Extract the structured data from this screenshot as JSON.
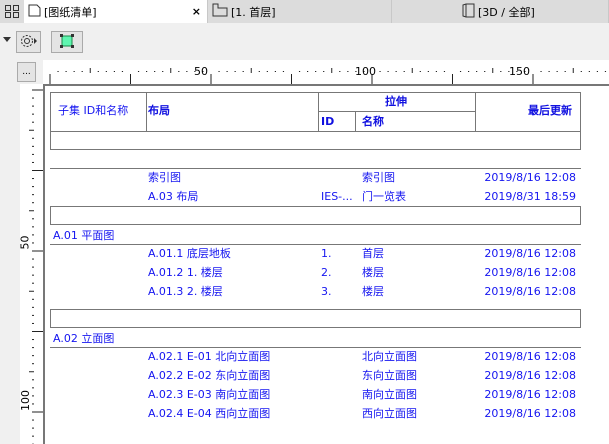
{
  "tabs": [
    {
      "label": "[图纸清单]",
      "icon": "document-icon",
      "active": true
    },
    {
      "label": "[1. 首层]",
      "icon": "floor-plan-icon"
    },
    {
      "label": "[3D / 全部]",
      "icon": "3d-box-icon"
    }
  ],
  "close_label": "×",
  "ruler": {
    "top_ticks": [
      "50",
      "100",
      "150"
    ],
    "left_ticks": [
      "50",
      "100"
    ],
    "corner": "..."
  },
  "header": {
    "col1": "子集 ID和名称",
    "col2": "布局",
    "group": "拉伸",
    "id": "ID",
    "name": "名称",
    "updated": "最后更新"
  },
  "rows_top": [
    {
      "layout": "索引图",
      "id": "",
      "name": "索引图",
      "date": "2019/8/16 12:08"
    },
    {
      "layout": "A.03 布局",
      "id": "IES-...",
      "name": "门一览表",
      "date": "2019/8/31 18:59"
    }
  ],
  "sections": [
    {
      "title": "A.01 平面图",
      "rows": [
        {
          "layout": "A.01.1 底层地板",
          "id": "1.",
          "name": "首层",
          "date": "2019/8/16 12:08"
        },
        {
          "layout": "A.01.2 1. 楼层",
          "id": "2.",
          "name": "楼层",
          "date": "2019/8/16 12:08"
        },
        {
          "layout": "A.01.3 2. 楼层",
          "id": "3.",
          "name": "楼层",
          "date": "2019/8/16 12:08"
        }
      ]
    },
    {
      "title": "A.02 立面图",
      "rows": [
        {
          "layout": "A.02.1 E-01 北向立面图",
          "id": "",
          "name": "北向立面图",
          "date": "2019/8/16 12:08"
        },
        {
          "layout": "A.02.2 E-02 东向立面图",
          "id": "",
          "name": "东向立面图",
          "date": "2019/8/16 12:08"
        },
        {
          "layout": "A.02.3 E-03 南向立面图",
          "id": "",
          "name": "南向立面图",
          "date": "2019/8/16 12:08"
        },
        {
          "layout": "A.02.4 E-04 西向立面图",
          "id": "",
          "name": "西向立面图",
          "date": "2019/8/16 12:08"
        }
      ]
    }
  ]
}
